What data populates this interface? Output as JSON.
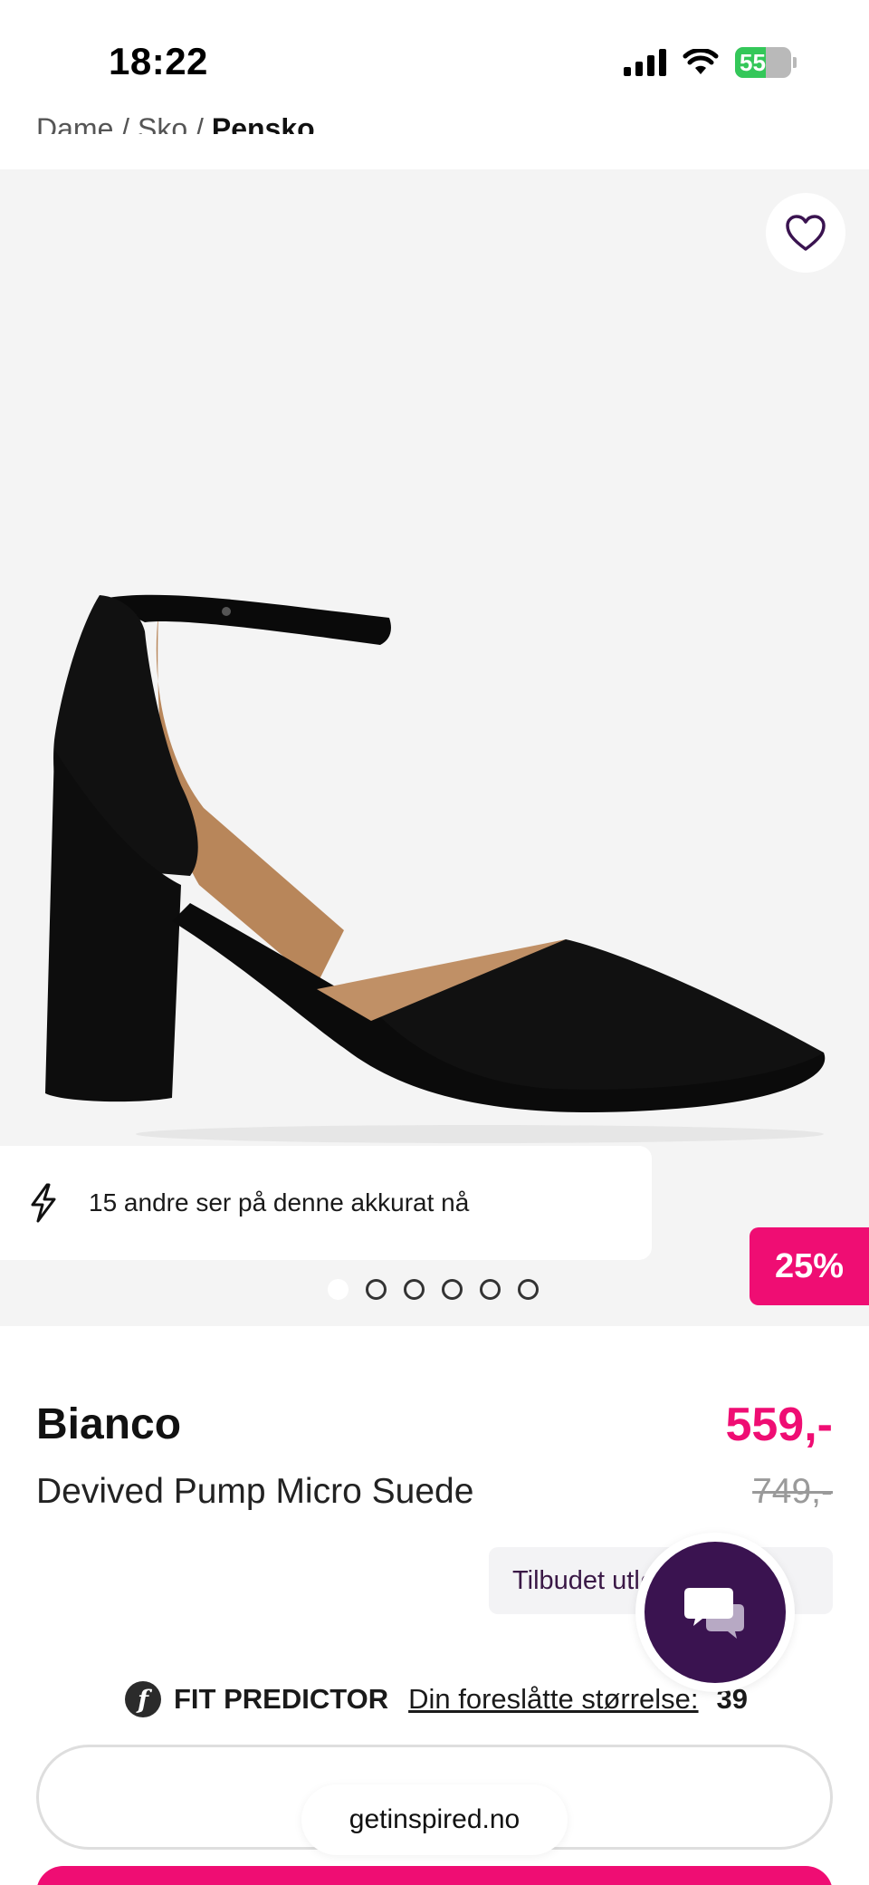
{
  "status_bar": {
    "time": "18:22",
    "battery": "55"
  },
  "breadcrumb": {
    "items": [
      "Dame",
      "Sko",
      "Pensko"
    ]
  },
  "gallery": {
    "viewer_text": "15 andre ser på denne akkurat nå",
    "discount": "25%",
    "dot_count": 6,
    "active_dot": 0
  },
  "product": {
    "brand": "Bianco",
    "name": "Devived Pump Micro Suede",
    "price": "559,-",
    "old_price": "749,-",
    "offer_text": "Tilbudet utløper 26"
  },
  "fit_predictor": {
    "logo": "f",
    "title": "FIT PREDICTOR",
    "link": "Din foreslåtte størrelse:",
    "size": "39"
  },
  "browser": {
    "url": "getinspired.no"
  },
  "colors": {
    "accent": "#ef0d73",
    "chat": "#3a1350"
  },
  "icons": [
    "heart-icon",
    "bolt-icon",
    "chat-icon",
    "signal-icon",
    "wifi-icon",
    "battery-icon"
  ]
}
